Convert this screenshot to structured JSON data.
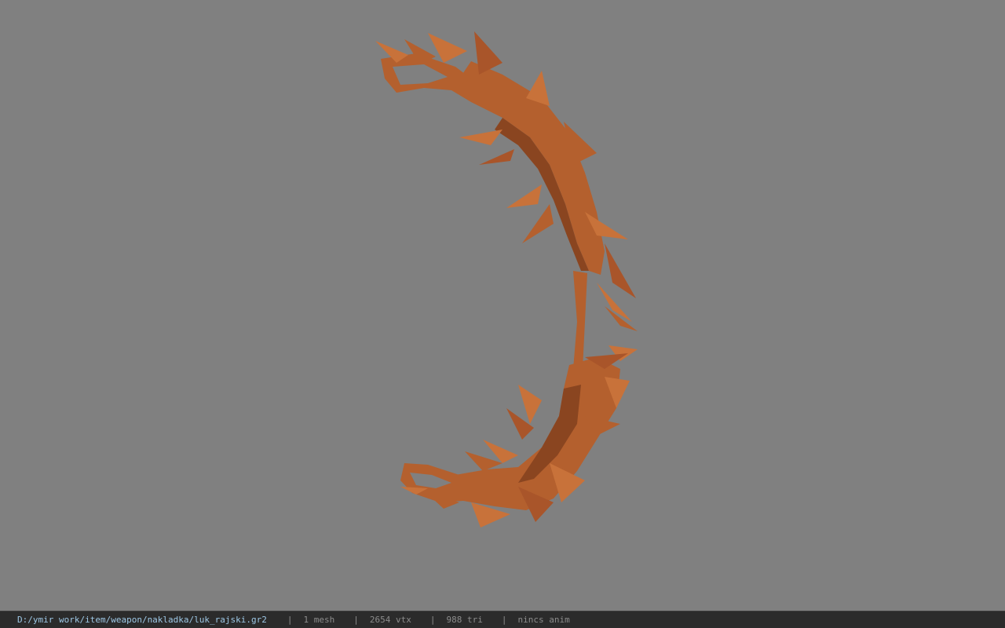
{
  "viewer": {
    "background_color": "#808080",
    "model_color": "#b4602e",
    "model_shade_dark": "#8a4520",
    "model_shade_light": "#c8723a",
    "model_description": "low-poly thorned bow attachment mesh"
  },
  "statusbar": {
    "file_path": "D:/ymir work/item/weapon/nakladka/luk_rajski.gr2",
    "separator": "|",
    "mesh_count": "1 mesh",
    "vertex_count": "2654 vtx",
    "triangle_count": "988 tri",
    "anim_status": "nincs anim",
    "background_color": "#2b2b2b",
    "path_color": "#9ec8e6"
  }
}
